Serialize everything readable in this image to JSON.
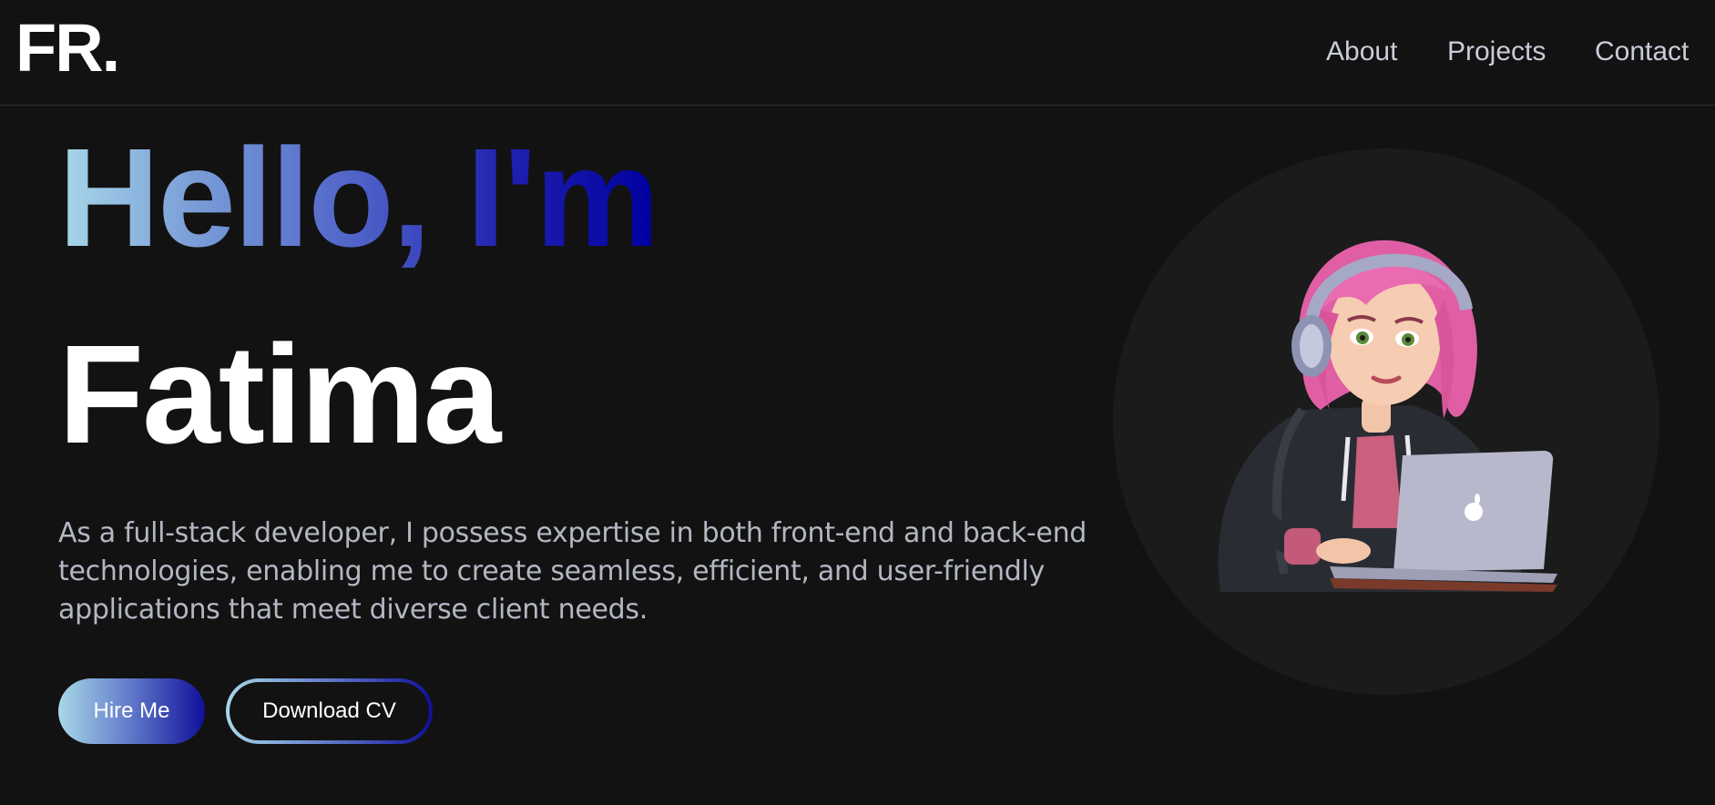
{
  "header": {
    "logo": "FR.",
    "nav": [
      "About",
      "Projects",
      "Contact"
    ]
  },
  "hero": {
    "greeting": "Hello, I'm",
    "name": "Fatima",
    "description": "As a full-stack developer, I possess expertise in both front-end and back-end technologies, enabling me to create seamless, efficient, and user-friendly applications that meet diverse client needs.",
    "buttons": {
      "hire": "Hire Me",
      "download_cv": "Download CV"
    }
  },
  "colors": {
    "background": "#121212",
    "gradient_start": "#a8d8e8",
    "gradient_end": "#0000a0",
    "text_muted": "#b3b7c2"
  },
  "illustration": "developer-girl-avatar"
}
